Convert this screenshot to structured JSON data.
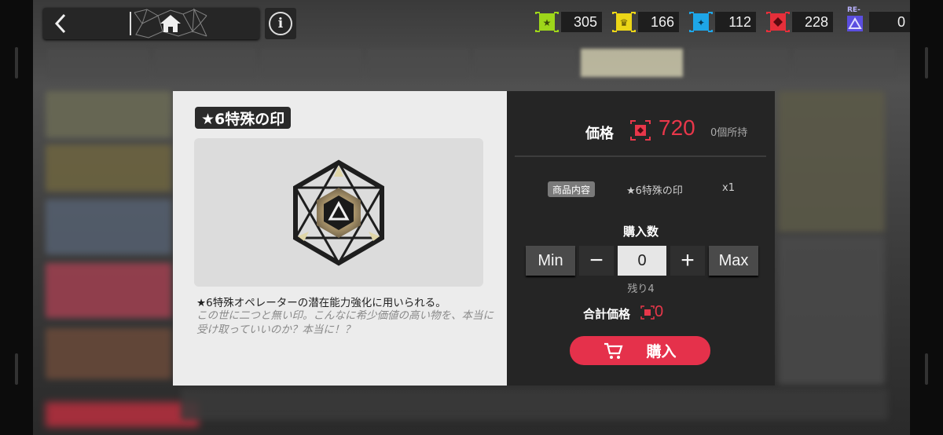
{
  "currencies": [
    {
      "name": "green-currency",
      "color": "#9ed61a",
      "value": "305"
    },
    {
      "name": "yellow-currency",
      "color": "#ecd617",
      "value": "166"
    },
    {
      "name": "blue-currency",
      "color": "#1ea6e8",
      "value": "112"
    },
    {
      "name": "red-currency",
      "color": "#e62f3a",
      "value": "228"
    },
    {
      "name": "purple-currency",
      "color": "#5b4ee0",
      "value": "0",
      "tag": "RE-"
    }
  ],
  "nav": {
    "back_icon": "back-arrow-icon",
    "home_icon": "home-icon",
    "info_label": "i"
  },
  "item": {
    "name": "★6特殊の印",
    "description": "★6特殊オペレーターの潜在能力強化に用いられる。",
    "flavor": "この世に二つと無い印。こんなに希少価値の高い物を、本当に受け取っていいのか？本当に！？"
  },
  "purchase": {
    "price_label": "価格",
    "price": "720",
    "owned": "0個所持",
    "contents_label": "商品内容",
    "contents_item": "★6特殊の印",
    "contents_qty": "x1",
    "qty_label": "購入数",
    "min_label": "Min",
    "minus_label": "−",
    "quantity": "0",
    "plus_label": "+",
    "max_label": "Max",
    "remaining": "残り4",
    "total_label": "合計価格",
    "total": "0",
    "buy_label": "購入"
  },
  "colors": {
    "accent": "#e5314b",
    "price": "#e8374a"
  }
}
